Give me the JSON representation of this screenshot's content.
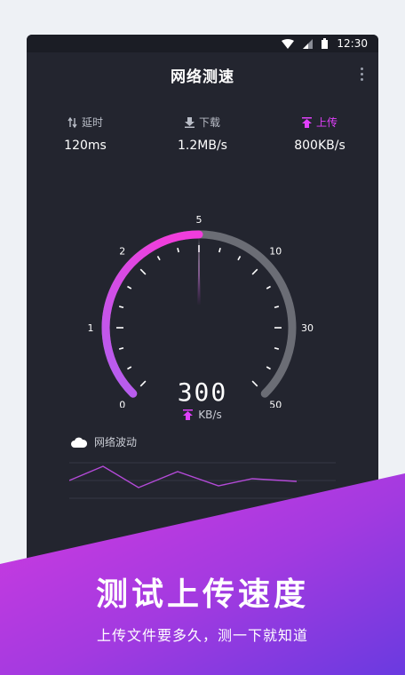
{
  "status_bar": {
    "time": "12:30",
    "icons": [
      "wifi-icon",
      "signal-icon",
      "battery-icon"
    ]
  },
  "app": {
    "title": "网络测速"
  },
  "stats": [
    {
      "label": "延时",
      "value": "120ms",
      "icon": "latency-arrows-icon"
    },
    {
      "label": "下载",
      "value": "1.2MB/s",
      "icon": "download-icon"
    },
    {
      "label": "上传",
      "value": "800KB/s",
      "icon": "upload-icon",
      "active": true
    }
  ],
  "gauge": {
    "scale_labels": [
      "0",
      "1",
      "2",
      "5",
      "10",
      "30",
      "50"
    ],
    "reading": "300",
    "unit": "KB/s",
    "progress": 0.5
  },
  "wave": {
    "label": "网络波动",
    "icon": "cloud-icon"
  },
  "banner": {
    "headline": "测试上传速度",
    "subline": "上传文件要多久，测一下就知道"
  },
  "colors": {
    "accent": "#e040fb",
    "accent_dark": "#9c3ee0",
    "panel": "#23252f",
    "track": "#6b6d75"
  }
}
